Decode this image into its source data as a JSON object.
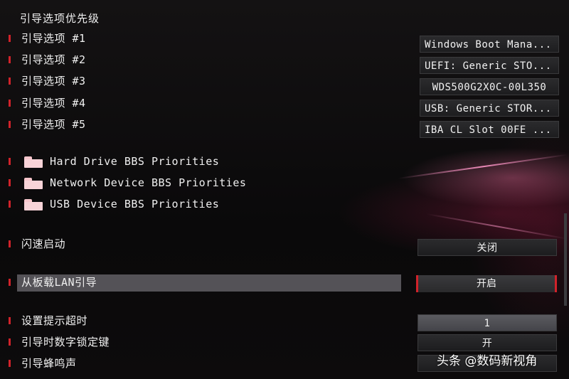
{
  "section_title": "引导选项优先级",
  "boot_options": [
    {
      "label": "引导选项 #1",
      "value": "Windows Boot Mana..."
    },
    {
      "label": "引导选项 #2",
      "value": "UEFI: Generic STO..."
    },
    {
      "label": "引导选项 #3",
      "value": "WDS500G2X0C-00L350"
    },
    {
      "label": "引导选项 #4",
      "value": "USB: Generic STOR..."
    },
    {
      "label": "引导选项 #5",
      "value": "IBA CL Slot 00FE ..."
    }
  ],
  "bbs_folders": [
    {
      "label": "Hard Drive BBS Priorities"
    },
    {
      "label": "Network Device BBS Priorities"
    },
    {
      "label": "USB Device BBS Priorities"
    }
  ],
  "settings": {
    "fast_boot": {
      "label": "闪速启动",
      "value": "关闭"
    },
    "onboard_lan_boot": {
      "label": "从板载LAN引导",
      "value": "开启"
    },
    "setup_prompt_timeout": {
      "label": "设置提示超时",
      "value": "1"
    },
    "bootup_numlock": {
      "label": "引导时数字锁定键",
      "value": "开"
    },
    "boot_beep": {
      "label": "引导蜂鸣声",
      "value": ""
    }
  },
  "watermark": "头条 @数码新视角",
  "colors": {
    "accent": "#d1222a",
    "highlight": "#545257",
    "background": "#0b0a0b"
  }
}
